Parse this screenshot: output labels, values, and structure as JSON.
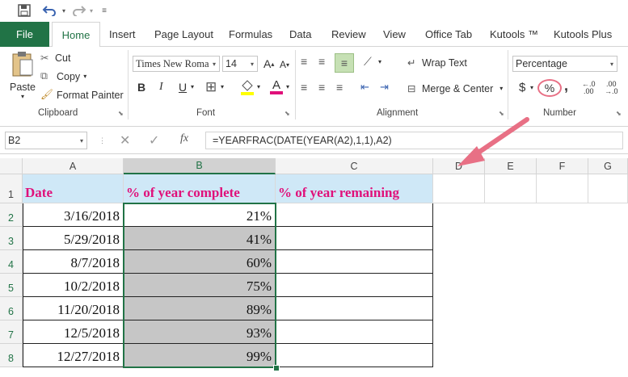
{
  "qat": {
    "save_icon": "save-icon",
    "undo_icon": "undo-icon",
    "redo_icon": "redo-icon"
  },
  "tabs": [
    "File",
    "Home",
    "Insert",
    "Page Layout",
    "Formulas",
    "Data",
    "Review",
    "View",
    "Office Tab",
    "Kutools ™",
    "Kutools Plus"
  ],
  "clipboard": {
    "paste": "Paste",
    "cut": "Cut",
    "copy": "Copy",
    "format_painter": "Format Painter",
    "label": "Clipboard"
  },
  "font": {
    "name": "Times New Roma",
    "size": "14",
    "bold": "B",
    "italic": "I",
    "underline": "U",
    "label": "Font"
  },
  "alignment": {
    "wrap_text": "Wrap Text",
    "merge_center": "Merge & Center",
    "label": "Alignment"
  },
  "number": {
    "format": "Percentage",
    "currency": "$",
    "percent": "%",
    "comma": ",",
    "label": "Number"
  },
  "formula_bar": {
    "name_box": "B2",
    "fx": "fx",
    "formula": "=YEARFRAC(DATE(YEAR(A2),1,1),A2)"
  },
  "columns": [
    "A",
    "B",
    "C",
    "D",
    "E",
    "F",
    "G"
  ],
  "rows": [
    "1",
    "2",
    "3",
    "4",
    "5",
    "6",
    "7",
    "8"
  ],
  "headers": {
    "a1": "Date",
    "b1": "% of year complete",
    "c1": "% of year remaining"
  },
  "table": [
    {
      "date": "3/16/2018",
      "pct": "21%"
    },
    {
      "date": "5/29/2018",
      "pct": "41%"
    },
    {
      "date": "8/7/2018",
      "pct": "60%"
    },
    {
      "date": "10/2/2018",
      "pct": "75%"
    },
    {
      "date": "11/20/2018",
      "pct": "89%"
    },
    {
      "date": "12/5/2018",
      "pct": "93%"
    },
    {
      "date": "12/27/2018",
      "pct": "99%"
    }
  ],
  "colors": {
    "accent": "#217346",
    "header_fill": "#cfe8f7",
    "header_text": "#e0107a",
    "selection_fill": "#c6c6c6",
    "arrow": "#e87085"
  }
}
